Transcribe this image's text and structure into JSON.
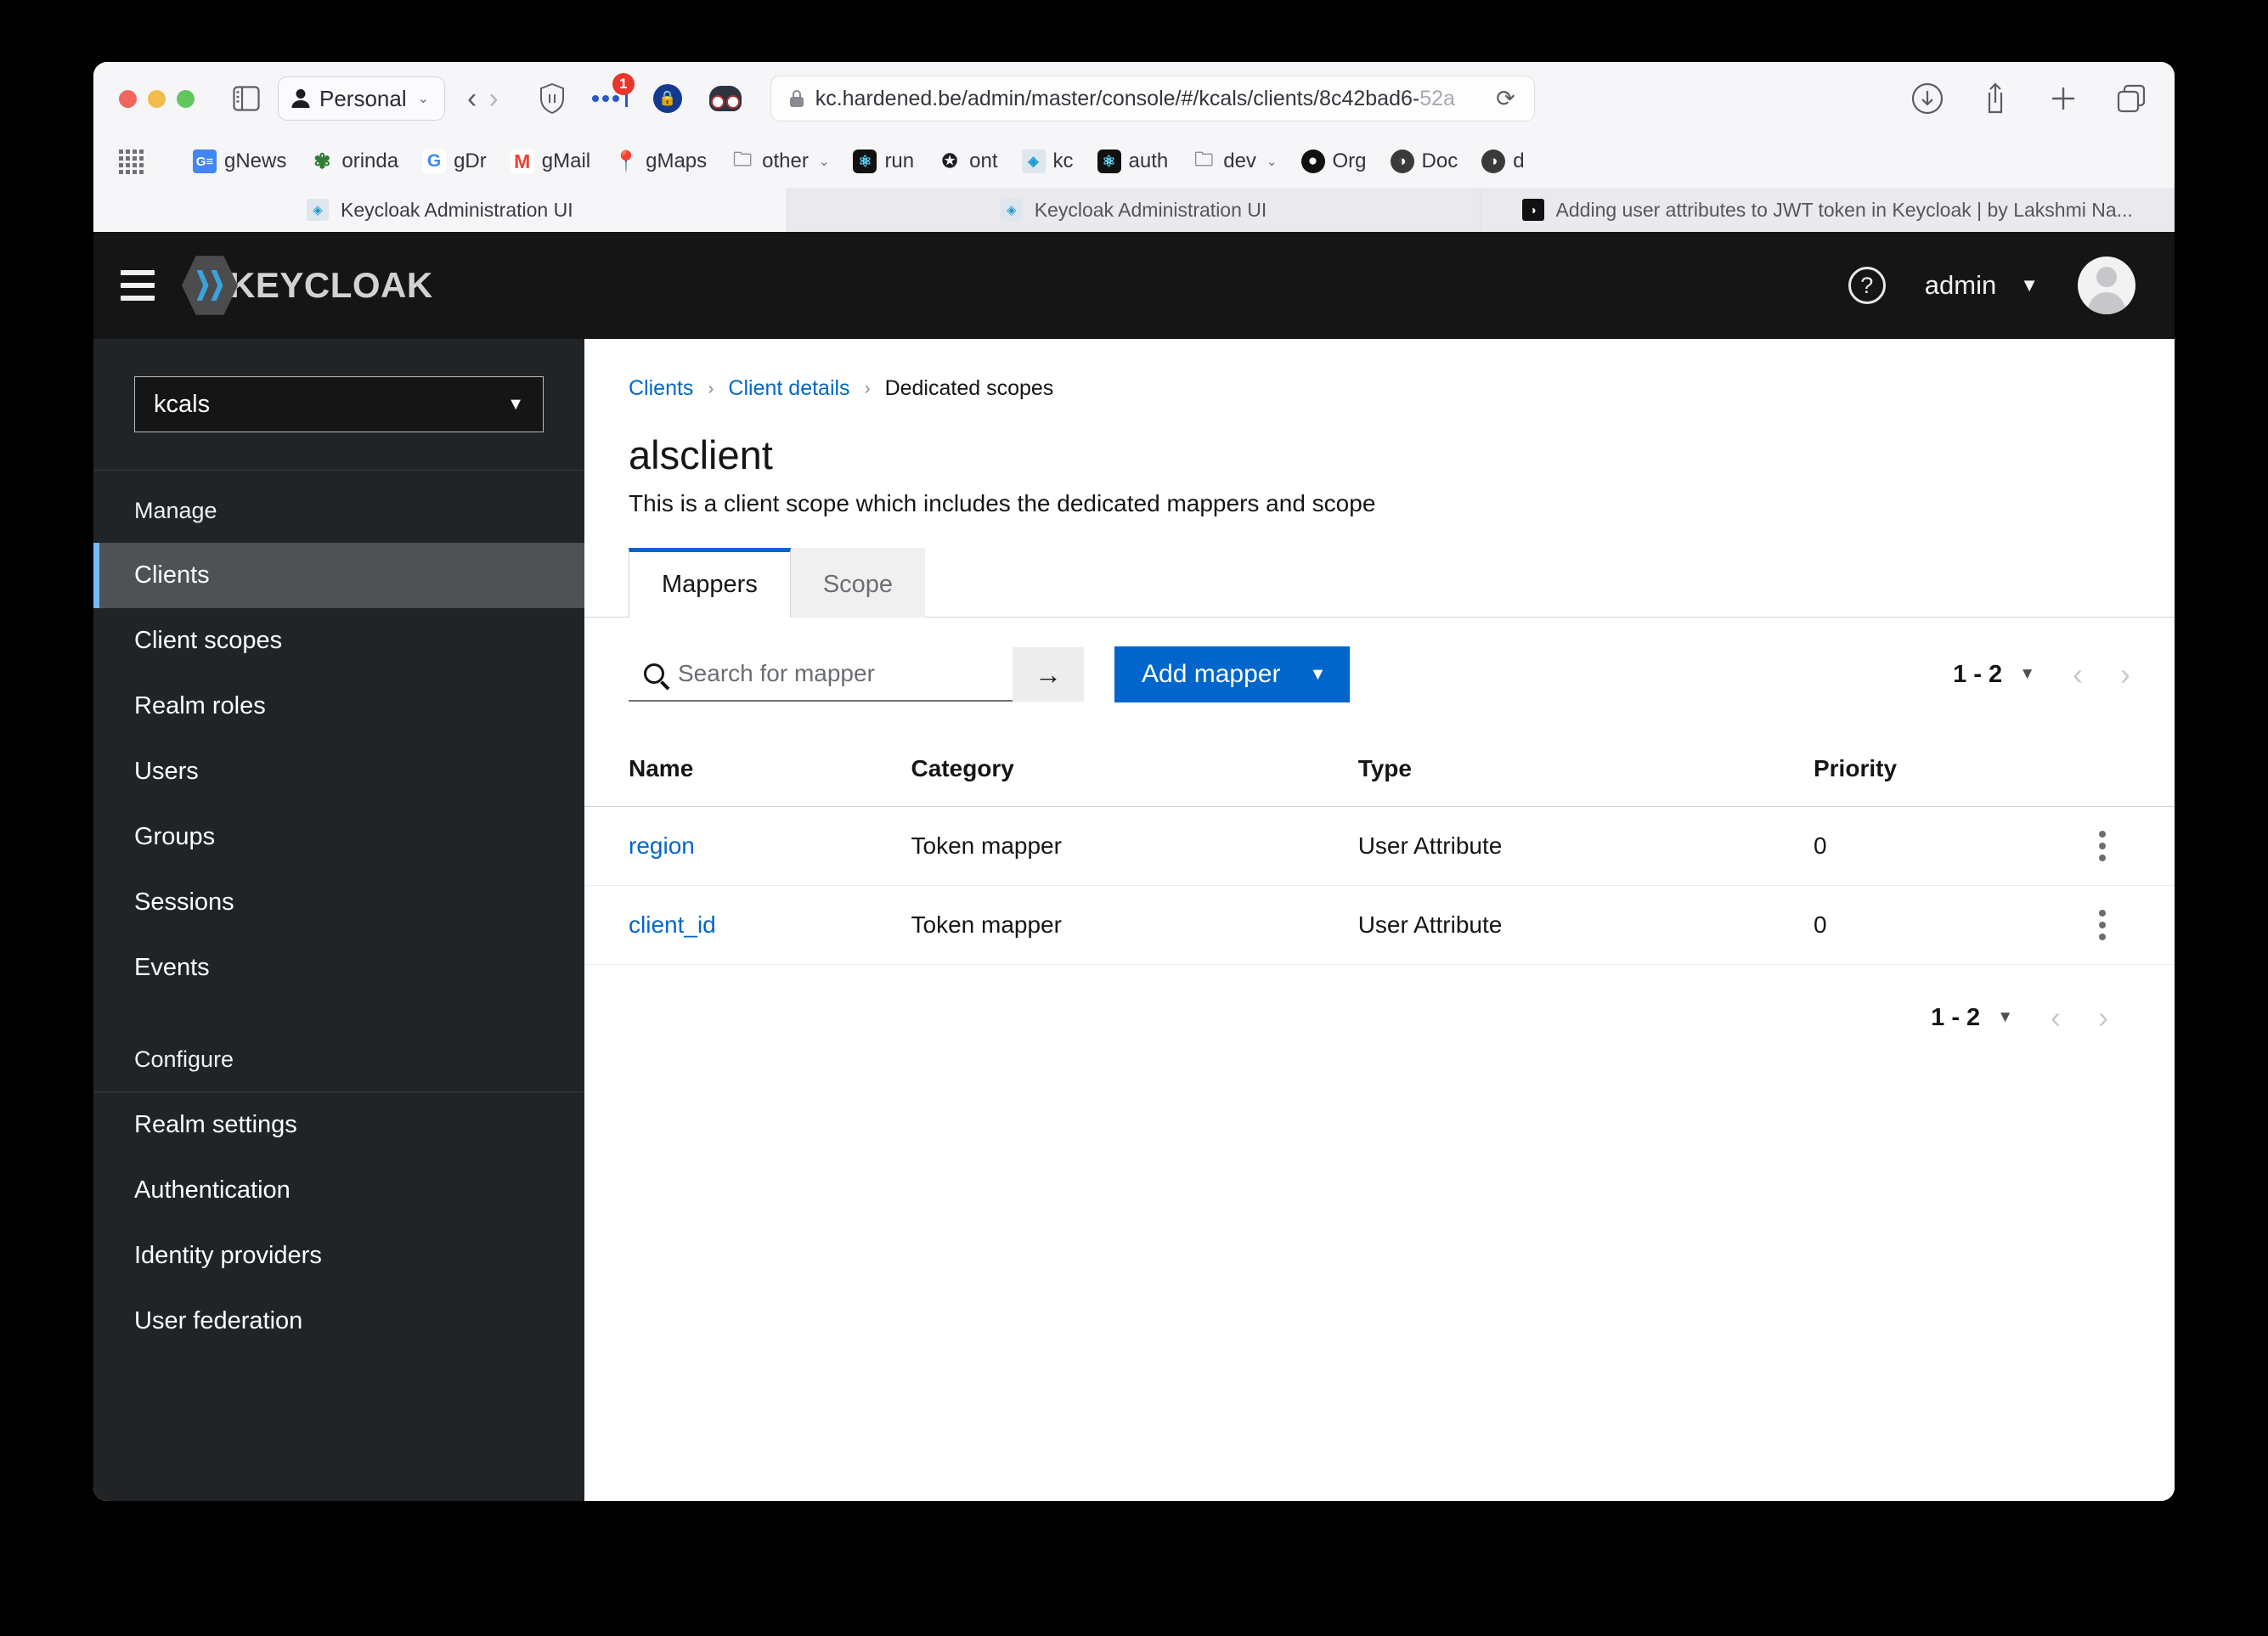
{
  "browser": {
    "profile_label": "Personal",
    "url": "kc.hardened.be/admin/master/console/#/kcals/clients/8c42bad6-",
    "url_fade": "52a",
    "extension_badge": "1",
    "bookmarks": [
      {
        "label": "gNews",
        "icon": "GE",
        "cls": "gnews",
        "caret": ""
      },
      {
        "label": "orinda",
        "icon": "✾",
        "cls": "orinda",
        "caret": ""
      },
      {
        "label": "gDr",
        "icon": "G",
        "cls": "gdr",
        "caret": ""
      },
      {
        "label": "gMail",
        "icon": "M",
        "cls": "gmail",
        "caret": ""
      },
      {
        "label": "gMaps",
        "icon": "◉",
        "cls": "gmaps",
        "caret": ""
      },
      {
        "label": "other",
        "icon": "🗀",
        "cls": "folder",
        "caret": "▾"
      },
      {
        "label": "run",
        "icon": "⚛",
        "cls": "react",
        "caret": ""
      },
      {
        "label": "ont",
        "icon": "✪",
        "cls": "ont",
        "caret": ""
      },
      {
        "label": "kc",
        "icon": "◈",
        "cls": "kc",
        "caret": ""
      },
      {
        "label": "auth",
        "icon": "⚛",
        "cls": "react",
        "caret": ""
      },
      {
        "label": "dev",
        "icon": "🗀",
        "cls": "folder",
        "caret": "▾"
      },
      {
        "label": "Org",
        "icon": "",
        "cls": "gh",
        "caret": ""
      },
      {
        "label": "Doc",
        "icon": "◑",
        "cls": "doc",
        "caret": ""
      },
      {
        "label": "d",
        "icon": "◑",
        "cls": "doc",
        "caret": ""
      }
    ],
    "tabs": [
      {
        "title": "Keycloak Administration UI",
        "favicon": "kc",
        "active": true
      },
      {
        "title": "Keycloak Administration UI",
        "favicon": "kc",
        "active": false
      },
      {
        "title": "Adding user attributes to JWT token in Keycloak | by Lakshmi Na...",
        "favicon": "medium",
        "active": false
      }
    ]
  },
  "header": {
    "brand": "KEYCLOAK",
    "help_icon": "?",
    "username": "admin",
    "caret": "▼"
  },
  "sidebar": {
    "realm": "kcals",
    "realm_caret": "▼",
    "manage_label": "Manage",
    "manage_items": [
      {
        "label": "Clients",
        "active": true
      },
      {
        "label": "Client scopes",
        "active": false
      },
      {
        "label": "Realm roles",
        "active": false
      },
      {
        "label": "Users",
        "active": false
      },
      {
        "label": "Groups",
        "active": false
      },
      {
        "label": "Sessions",
        "active": false
      },
      {
        "label": "Events",
        "active": false
      }
    ],
    "configure_label": "Configure",
    "configure_items": [
      {
        "label": "Realm settings",
        "active": false
      },
      {
        "label": "Authentication",
        "active": false
      },
      {
        "label": "Identity providers",
        "active": false
      },
      {
        "label": "User federation",
        "active": false
      }
    ]
  },
  "main": {
    "breadcrumb": [
      {
        "label": "Clients",
        "link": true
      },
      {
        "label": "Client details",
        "link": true
      },
      {
        "label": "Dedicated scopes",
        "link": false
      }
    ],
    "breadcrumb_sep": "›",
    "title": "alsclient",
    "subtitle": "This is a client scope which includes the dedicated mappers and scope",
    "tabs": [
      {
        "label": "Mappers",
        "active": true
      },
      {
        "label": "Scope",
        "active": false
      }
    ],
    "search_placeholder": "Search for mapper",
    "search_value": "",
    "search_submit_icon": "→",
    "add_button": "Add mapper",
    "add_button_caret": "▼",
    "pagination": {
      "range": "1 - 2",
      "caret": "▼",
      "prev": "‹",
      "next": "›"
    },
    "table": {
      "columns": [
        "Name",
        "Category",
        "Type",
        "Priority"
      ],
      "rows": [
        {
          "name": "region",
          "category": "Token mapper",
          "type": "User Attribute",
          "priority": "0"
        },
        {
          "name": "client_id",
          "category": "Token mapper",
          "type": "User Attribute",
          "priority": "0"
        }
      ]
    }
  },
  "colors": {
    "accent": "#0066cc",
    "header_bg": "#151515",
    "sidebar_bg": "#212427",
    "active_nav": "#4f5255",
    "active_nav_border": "#73bcf7"
  }
}
